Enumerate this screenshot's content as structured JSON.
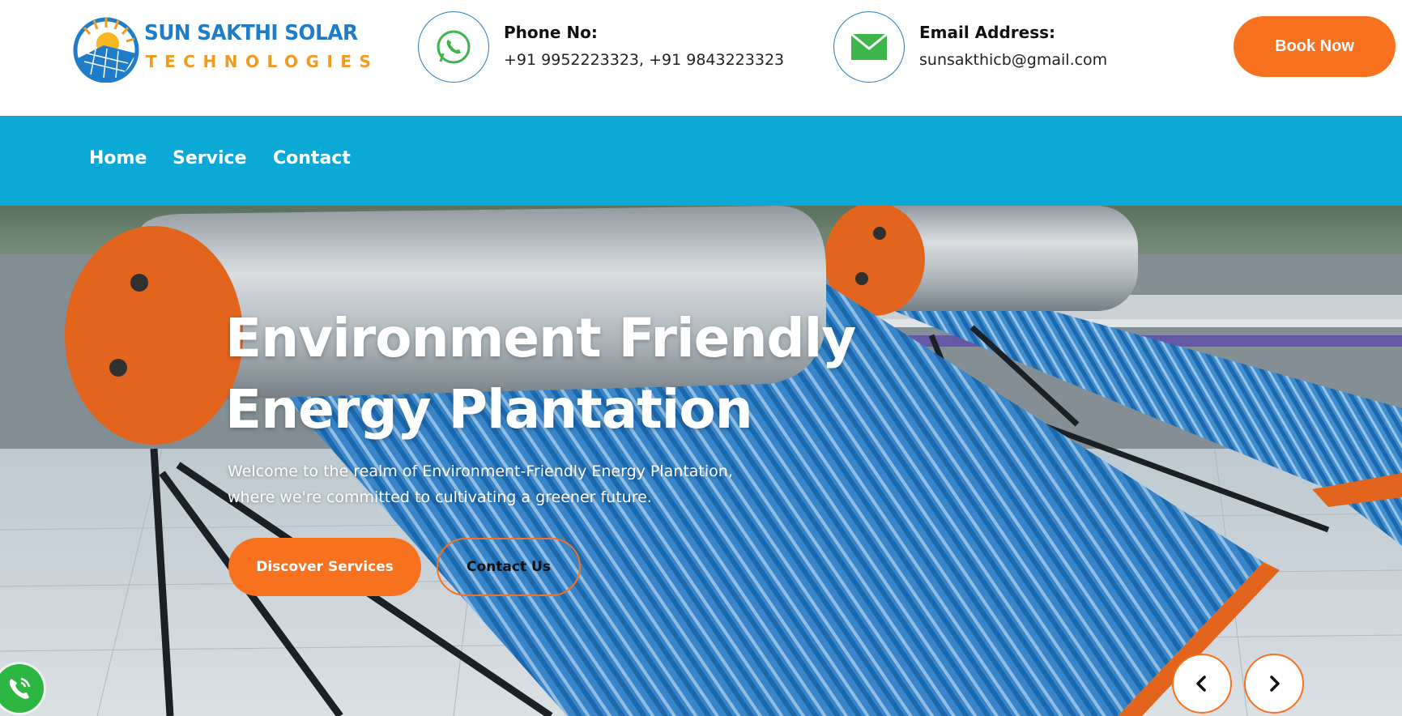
{
  "brand": {
    "name_line1": "SUN SAKTHI SOLAR",
    "name_line2": "TECHNOLOGIES",
    "primary_color": "#1f7cc9",
    "secondary_color": "#f39a1d"
  },
  "header": {
    "phone": {
      "icon": "whatsapp-icon",
      "label": "Phone No:",
      "value": "+91 9952223323, +91 9843223323"
    },
    "email": {
      "icon": "mail-icon",
      "label": "Email Address:",
      "value": "sunsakthicb@gmail.com"
    },
    "book_button": "Book Now"
  },
  "nav": {
    "background": "#0aa9d6",
    "items": [
      {
        "label": "Home"
      },
      {
        "label": "Service"
      },
      {
        "label": "Contact"
      }
    ]
  },
  "hero": {
    "title_line1": "Environment Friendly",
    "title_line2": "Energy Plantation",
    "subtitle_line1": "Welcome to the realm of Environment-Friendly Energy Plantation,",
    "subtitle_line2": "where we're committed to cultivating a greener future.",
    "primary_button": "Discover Services",
    "secondary_button": "Contact Us",
    "accent_color": "#f7711e",
    "prev_icon": "chevron-left-icon",
    "next_icon": "chevron-right-icon"
  },
  "floating": {
    "call_icon": "phone-call-icon"
  }
}
